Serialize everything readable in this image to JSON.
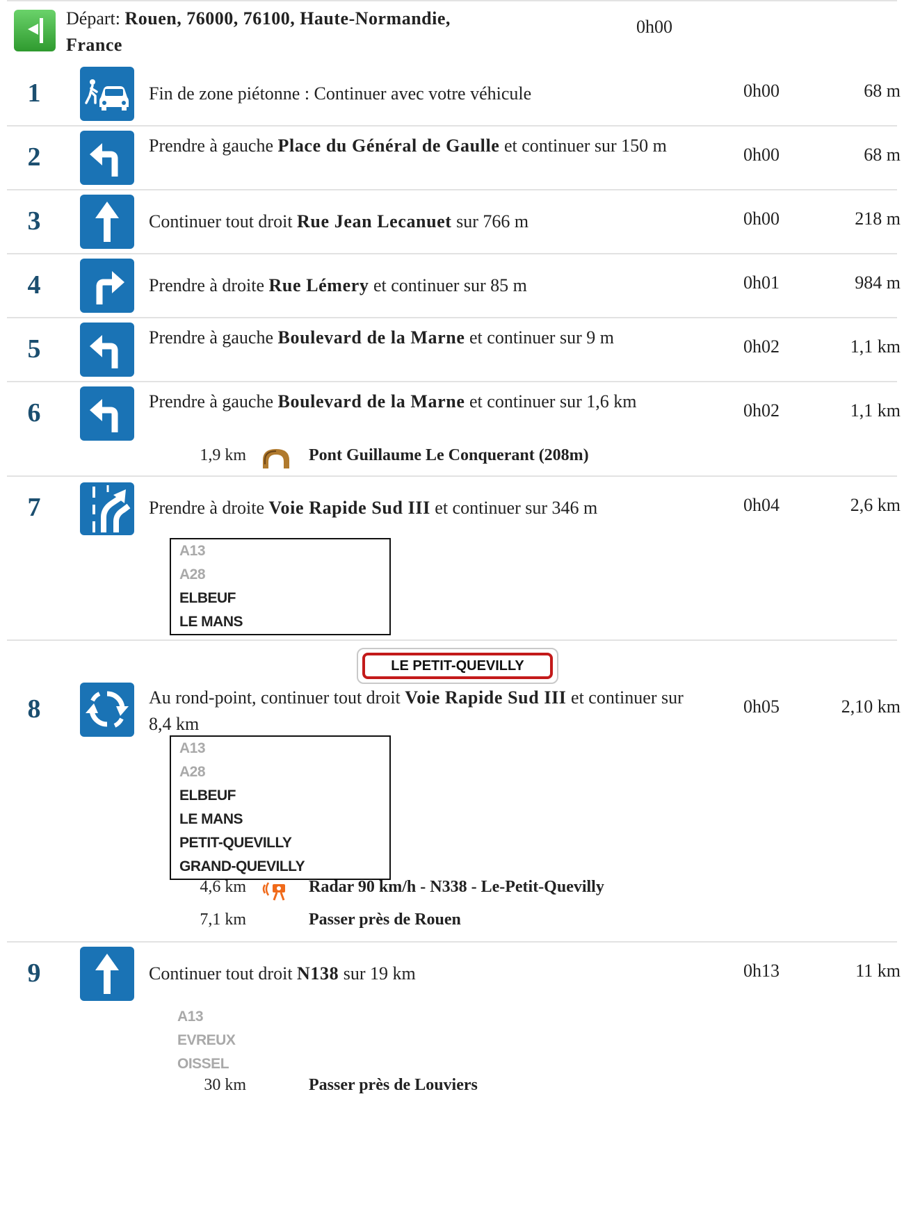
{
  "departure": {
    "prefix": "Départ: ",
    "place": "Rouen, 76000, 76100, Haute-Normandie, France",
    "time": "0h00",
    "icon": "start-flag-icon",
    "color": "#3faa3f"
  },
  "accent_color": "#1a73b5",
  "steps": [
    {
      "num": "1",
      "icon": "pedestrian-zone-end-icon",
      "text_a": "Fin de zone piétonne : Continuer avec votre véhicule",
      "road": "",
      "text_b": "",
      "time": "0h00",
      "dist": "68 m"
    },
    {
      "num": "2",
      "icon": "turn-left-icon",
      "text_a": "Prendre à gauche ",
      "road": "Place du Général de Gaulle",
      "text_b": " et continuer sur 150 m",
      "time": "0h00",
      "dist": "68 m"
    },
    {
      "num": "3",
      "icon": "straight-arrow-icon",
      "text_a": "Continuer tout droit ",
      "road": "Rue Jean Lecanuet",
      "text_b": " sur 766 m",
      "time": "0h00",
      "dist": "218 m"
    },
    {
      "num": "4",
      "icon": "turn-right-icon",
      "text_a": "Prendre à droite ",
      "road": "Rue Lémery",
      "text_b": " et continuer sur 85 m",
      "time": "0h01",
      "dist": "984 m"
    },
    {
      "num": "5",
      "icon": "turn-left-icon",
      "text_a": "Prendre à gauche ",
      "road": "Boulevard de la Marne",
      "text_b": " et continuer sur 9 m",
      "time": "0h02",
      "dist": "1,1 km"
    },
    {
      "num": "6",
      "icon": "turn-left-icon",
      "text_a": "Prendre à gauche ",
      "road": "Boulevard de la Marne",
      "text_b": " et continuer sur 1,6 km",
      "time": "0h02",
      "dist": "1,1 km",
      "sub": [
        {
          "km": "1,9 km",
          "icon": "bridge-icon",
          "text": "Pont Guillaume Le Conquerant (208m)"
        }
      ]
    },
    {
      "num": "7",
      "icon": "keep-right-lane-icon",
      "text_a": "Prendre à droite ",
      "road": "Voie Rapide Sud III",
      "text_b": " et continuer sur 346 m",
      "time": "0h04",
      "dist": "2,6 km",
      "sign": [
        "A13",
        "A28",
        "ELBEUF",
        "LE MANS"
      ]
    },
    {
      "num": "8",
      "icon": "roundabout-icon",
      "town": "LE PETIT-QUEVILLY",
      "text_a": "Au rond-point, continuer tout droit ",
      "road": "Voie Rapide Sud III",
      "text_b": " et continuer sur 8,4 km",
      "time": "0h05",
      "dist": "2,10 km",
      "sign": [
        "A13",
        "A28",
        "ELBEUF",
        "LE MANS",
        "PETIT-QUEVILLY",
        "GRAND-QUEVILLY"
      ],
      "sub": [
        {
          "km": "4,6 km",
          "icon": "speed-camera-icon",
          "text": "Radar 90 km/h - N338 - Le-Petit-Quevilly"
        },
        {
          "km": "7,1 km",
          "icon": "",
          "text": "Passer près de Rouen"
        }
      ]
    },
    {
      "num": "9",
      "icon": "straight-arrow-icon",
      "text_a": "Continuer tout droit ",
      "road": "N138",
      "text_b": " sur 19 km",
      "time": "0h13",
      "dist": "11 km",
      "sign": [
        "A13",
        "EVREUX",
        "OISSEL"
      ],
      "sub": [
        {
          "km": "30 km",
          "icon": "",
          "text": "Passer près de Louviers"
        }
      ]
    }
  ]
}
